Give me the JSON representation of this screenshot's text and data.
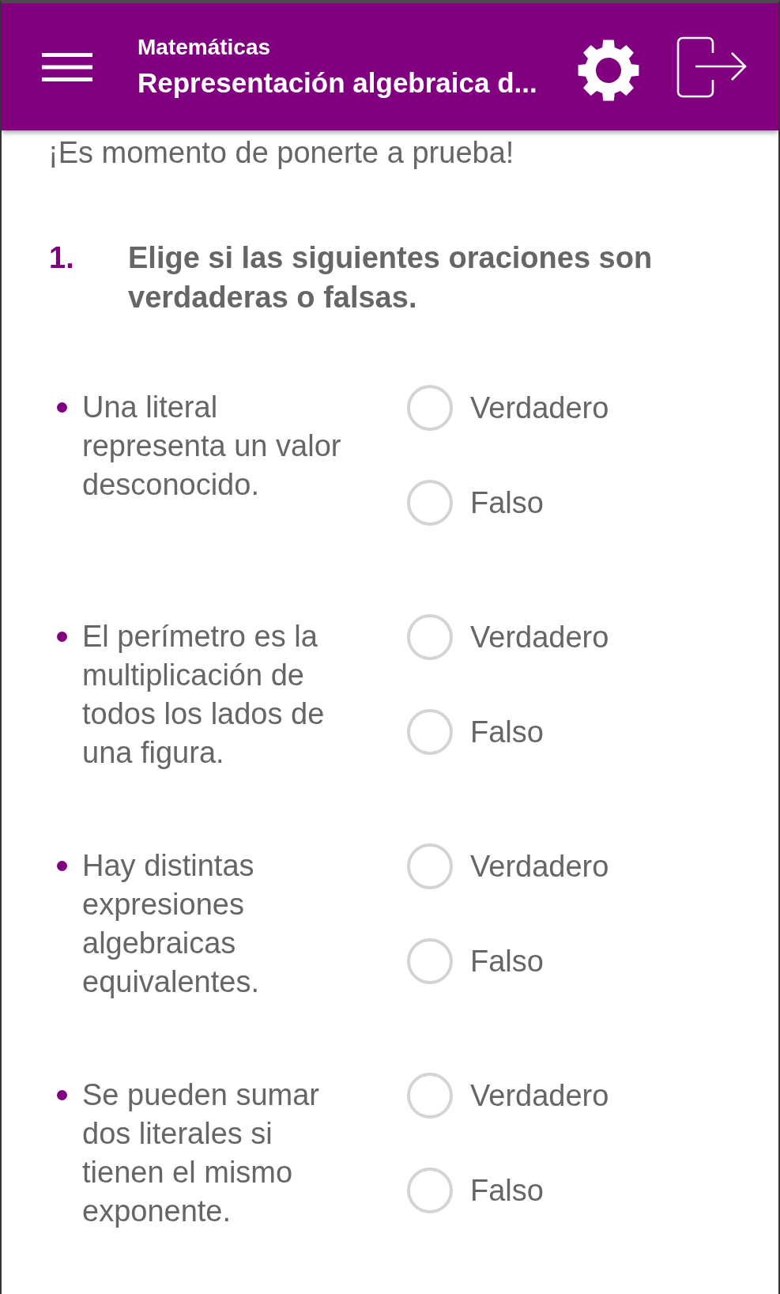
{
  "header": {
    "subject": "Matemáticas",
    "title": "Representación algebraica d..."
  },
  "intro": "¡Es momento de ponerte a prueba!",
  "question": {
    "number": "1.",
    "text": "Elige si las siguientes oraciones son verdaderas o falsas."
  },
  "statements": [
    {
      "text": "Una literal representa un valor desconocido.",
      "options": [
        {
          "label": "Verdadero",
          "selected": false
        },
        {
          "label": "Falso",
          "selected": false
        }
      ]
    },
    {
      "text": "El perímetro es la multiplicación de todos los lados de una figura.",
      "options": [
        {
          "label": "Verdadero",
          "selected": false
        },
        {
          "label": "Falso",
          "selected": false
        }
      ]
    },
    {
      "text": "Hay distintas expresiones algebraicas equivalentes.",
      "options": [
        {
          "label": "Verdadero",
          "selected": false
        },
        {
          "label": "Falso",
          "selected": false
        }
      ]
    },
    {
      "text": "Se pueden sumar dos literales si tienen el mismo exponente.",
      "options": [
        {
          "label": "Verdadero",
          "selected": false
        },
        {
          "label": "Falso",
          "selected": false
        }
      ]
    }
  ]
}
